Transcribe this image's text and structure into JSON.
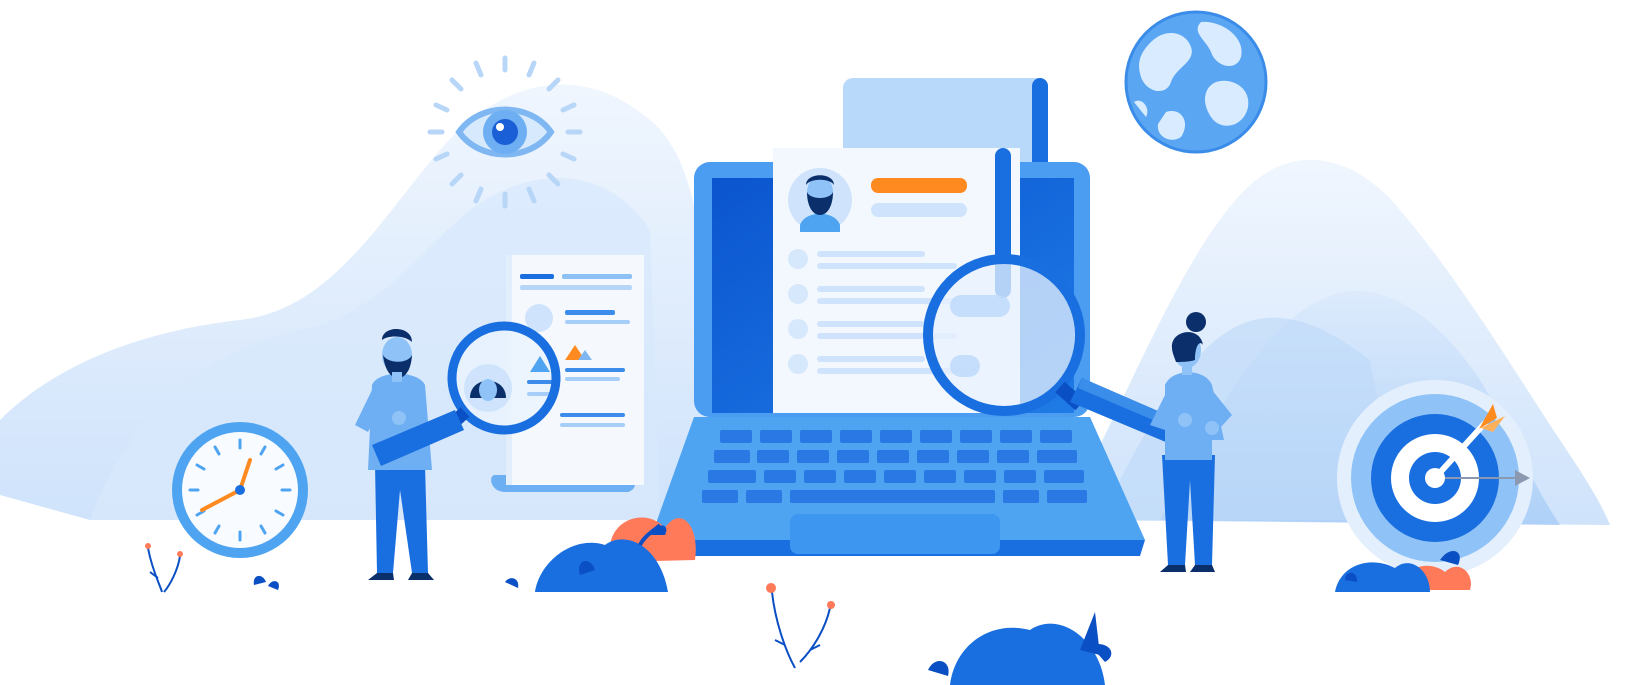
{
  "colors": {
    "background": "#ffffff",
    "hill_light": "#e7f1fd",
    "hill_mid": "#c9e0fb",
    "primary_blue": "#1a6fe0",
    "dark_blue": "#0b4fc4",
    "light_blue": "#4fa4f2",
    "pale_blue": "#d6e8fc",
    "paper": "#f3f8fe",
    "accent_orange": "#ff8a1f",
    "accent_coral": "#ff7a59",
    "skin_blue": "#8fc3f7"
  },
  "icons": [
    "globe-icon",
    "eye-icon",
    "clock-icon",
    "target-icon",
    "magnifier-icon",
    "resume-document-icon",
    "laptop-icon"
  ],
  "figures": [
    "man-with-magnifier",
    "woman-with-magnifier"
  ]
}
